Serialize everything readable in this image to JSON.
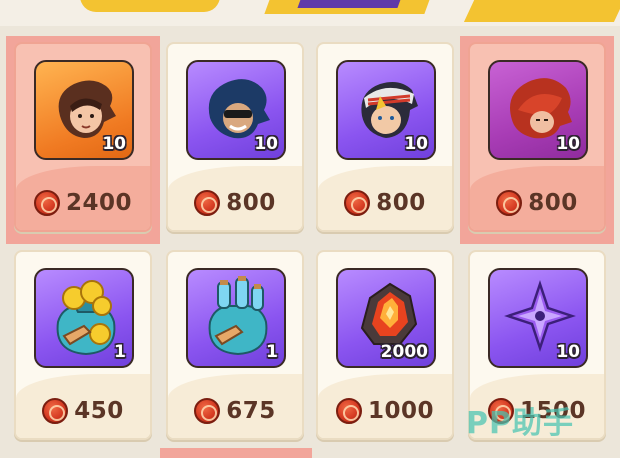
{
  "shop": {
    "items": [
      {
        "kind": "hero-shard",
        "qty": "10",
        "price": "2400",
        "highlighted": true,
        "bg": "orange"
      },
      {
        "kind": "hero-shard",
        "qty": "10",
        "price": "800",
        "highlighted": false,
        "bg": "purple"
      },
      {
        "kind": "hero-shard",
        "qty": "10",
        "price": "800",
        "highlighted": false,
        "bg": "purple"
      },
      {
        "kind": "hero-shard",
        "qty": "10",
        "price": "800",
        "highlighted": true,
        "bg": "magenta"
      },
      {
        "kind": "gold-bag",
        "qty": "1",
        "price": "450",
        "highlighted": false,
        "bg": "purple"
      },
      {
        "kind": "exp-potion-bag",
        "qty": "1",
        "price": "675",
        "highlighted": false,
        "bg": "purple"
      },
      {
        "kind": "fire-crystal",
        "qty": "2000",
        "price": "1000",
        "highlighted": false,
        "bg": "purple"
      },
      {
        "kind": "shuriken",
        "qty": "10",
        "price": "1500",
        "highlighted": false,
        "bg": "purple"
      }
    ]
  },
  "watermark": "PP助手",
  "colors": {
    "background": "#ece6da",
    "highlight": "#f2a59a",
    "coin": "#d53a22",
    "price_text": "#5b3526"
  }
}
